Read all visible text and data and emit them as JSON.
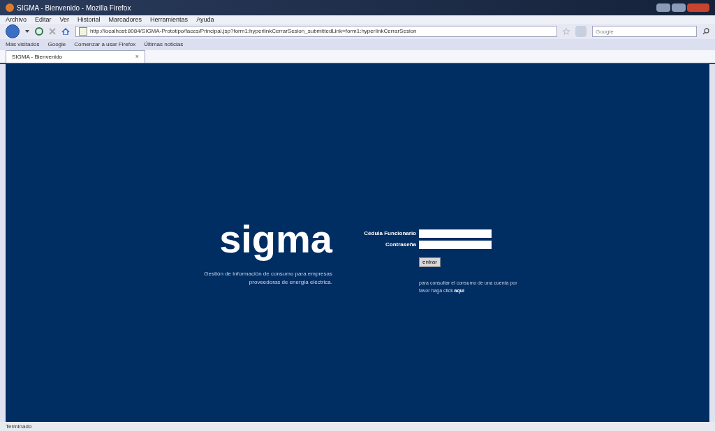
{
  "window": {
    "title": "SIGMA - Bienvenido - Mozilla Firefox"
  },
  "menu": [
    "Archivo",
    "Editar",
    "Ver",
    "Historial",
    "Marcadores",
    "Herramientas",
    "Ayuda"
  ],
  "address": {
    "value": "http://localhost:8084/SIGMA-Prototipo/faces/Principal.jsp?form1:hyperlinkCerrarSesion_submittedLink=form1:hyperlinkCerrarSesion"
  },
  "search": {
    "placeholder": "Google"
  },
  "bookmarks": [
    "Más visitados",
    "Google",
    "Comenzar a usar Firefox",
    "Últimas noticias"
  ],
  "tabs": [
    {
      "label": "SIGMA - Bienvenido",
      "selected": true,
      "close": "×"
    }
  ],
  "page": {
    "logo": "sigma",
    "tagline": "Gestión de información de consumo para empresas proveedoras de energía eléctrica.",
    "fields": [
      {
        "label": "Cédula Funcionario"
      },
      {
        "label": "Contraseña"
      }
    ],
    "button": "entrar",
    "note": "para consultar el consumo de una cuenta por favor haga click",
    "link": "aquí"
  },
  "status_bar": "Terminado"
}
